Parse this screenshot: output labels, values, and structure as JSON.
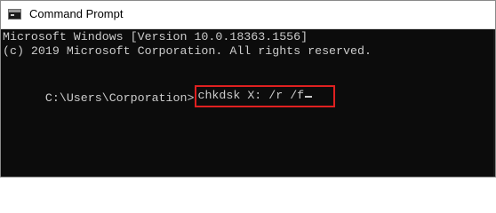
{
  "window": {
    "title": "Command Prompt",
    "icon": "cmd-icon"
  },
  "console": {
    "lines": [
      "Microsoft Windows [Version 10.0.18363.1556]",
      "(c) 2019 Microsoft Corporation. All rights reserved."
    ],
    "prompt": "C:\\Users\\Corporation>",
    "command": "chkdsk X: /r /f"
  },
  "colors": {
    "console_background": "#0c0c0c",
    "console_text": "#cccccc",
    "highlight_border": "#e02020"
  }
}
